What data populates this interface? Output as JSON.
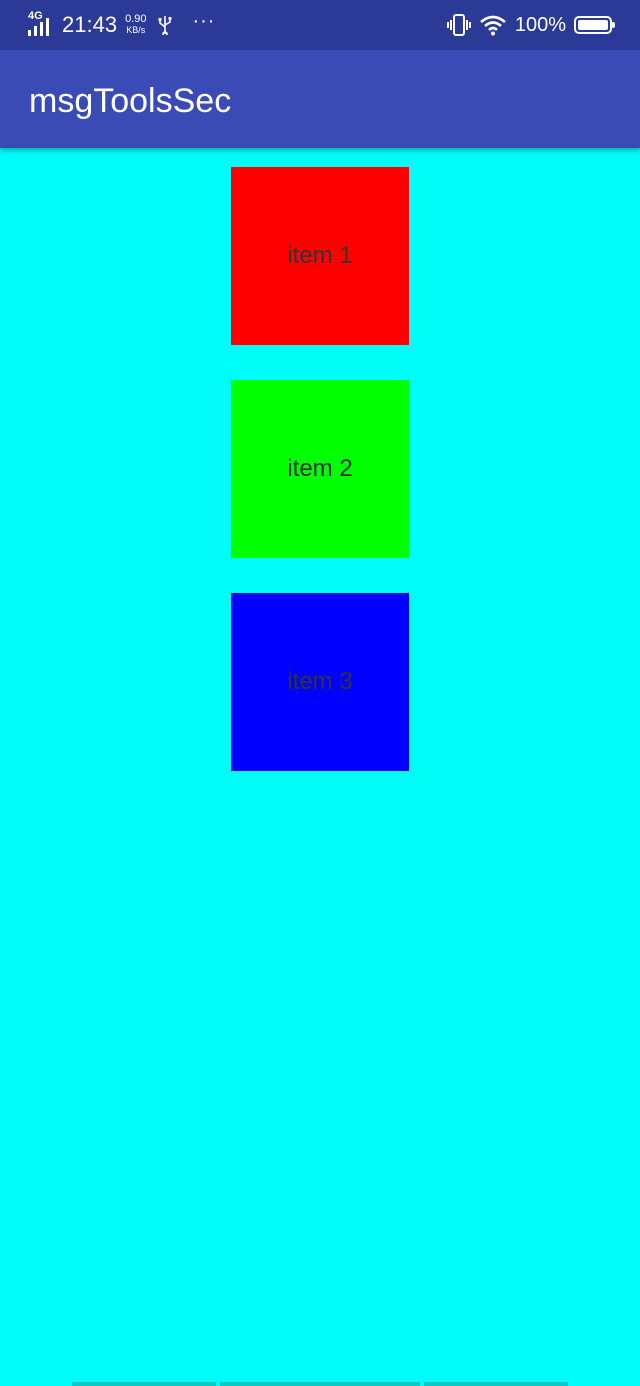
{
  "status_bar": {
    "network": "4G",
    "time": "21:43",
    "speed_value": "0.90",
    "speed_unit": "KB/s",
    "more": "···",
    "battery_percent": "100%"
  },
  "app_bar": {
    "title": "msgToolsSec"
  },
  "items": [
    {
      "label": "item 1",
      "color": "#FF0000"
    },
    {
      "label": "item 2",
      "color": "#00FF00"
    },
    {
      "label": "item 3",
      "color": "#0000FF"
    }
  ],
  "colors": {
    "status_bar": "#2B3A96",
    "app_bar": "#3B4BB5",
    "background": "#00FBF9"
  }
}
